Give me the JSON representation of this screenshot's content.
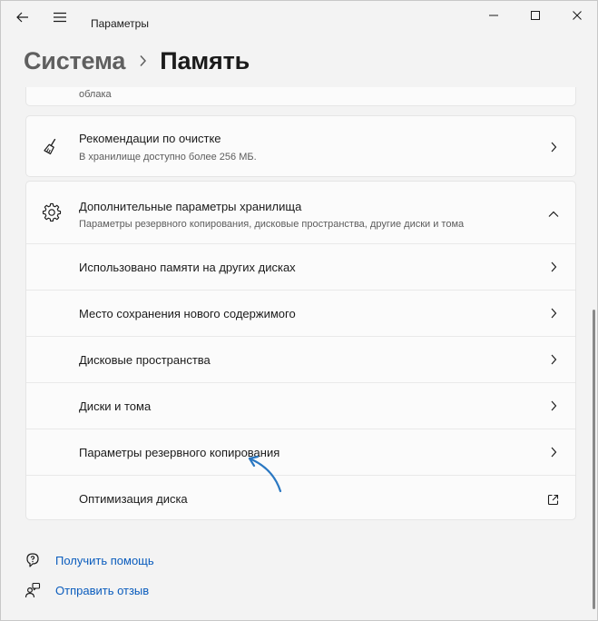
{
  "window": {
    "title": "Параметры"
  },
  "header": {
    "parent": "Система",
    "current": "Память"
  },
  "cards": {
    "top_partial_text": "облака",
    "cleanup": {
      "title": "Рекомендации по очистке",
      "subtitle": "В хранилище доступно более 256 МБ."
    },
    "advanced": {
      "title": "Дополнительные параметры хранилища",
      "subtitle": "Параметры резервного копирования, дисковые пространства, другие диски и тома",
      "items": [
        {
          "label": "Использовано памяти на других дисках",
          "action": "chevron-right"
        },
        {
          "label": "Место сохранения нового содержимого",
          "action": "chevron-right"
        },
        {
          "label": "Дисковые пространства",
          "action": "chevron-right"
        },
        {
          "label": "Диски и тома",
          "action": "chevron-right"
        },
        {
          "label": "Параметры резервного копирования",
          "action": "chevron-right"
        },
        {
          "label": "Оптимизация диска",
          "action": "external-link"
        }
      ]
    }
  },
  "links": {
    "help": "Получить помощь",
    "feedback": "Отправить отзыв"
  },
  "colors": {
    "accent": "#0a5cbd",
    "annotation_arrow": "#2b78c2",
    "background": "#f3f3f3",
    "card": "#fbfbfb"
  }
}
